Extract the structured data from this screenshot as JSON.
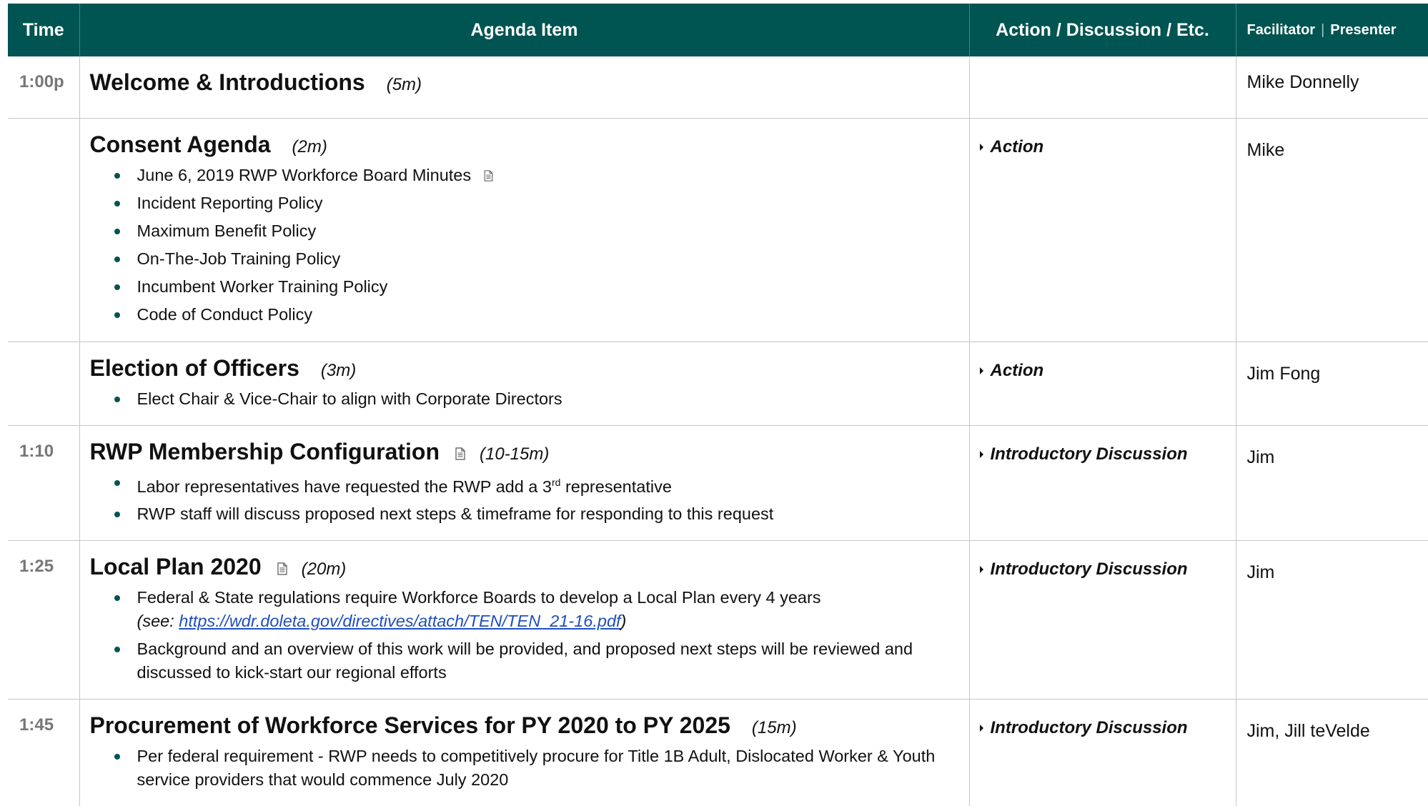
{
  "header": {
    "time": "Time",
    "item": "Agenda Item",
    "action": "Action / Discussion / Etc.",
    "facilitator": "Facilitator",
    "presenter": "Presenter"
  },
  "rows": [
    {
      "time": "1:00p",
      "title": "Welcome & Introductions",
      "duration": "(5m)",
      "bullets": [],
      "action": "",
      "facilitator": "Mike Donnelly"
    },
    {
      "time": "",
      "title": "Consent Agenda",
      "duration": "(2m)",
      "bullets": [
        "June 6, 2019 RWP Workforce Board Minutes",
        "Incident Reporting Policy",
        "Maximum Benefit Policy",
        "On-The-Job Training Policy",
        "Incumbent Worker Training Policy",
        "Code of Conduct Policy"
      ],
      "action": "Action",
      "facilitator": "Mike"
    },
    {
      "time": "",
      "title": "Election of Officers",
      "duration": "(3m)",
      "bullets": [
        "Elect Chair & Vice-Chair to align with Corporate Directors"
      ],
      "action": "Action",
      "facilitator": "Jim Fong"
    },
    {
      "time": "1:10",
      "title": "RWP Membership Configuration",
      "duration": "(10-15m)",
      "bullets": [
        {
          "pre": "Labor representatives have requested the RWP add a 3",
          "sup": "rd",
          "post": " representative"
        },
        "RWP staff will discuss proposed next steps & timeframe for responding to this request"
      ],
      "action": "Introductory Discussion",
      "facilitator": "Jim"
    },
    {
      "time": "1:25",
      "title": "Local Plan 2020",
      "duration": "(20m)",
      "bullets": [
        {
          "text": "Federal & State regulations require Workforce Boards to develop a Local Plan every 4 years",
          "see_prefix": "(see: ",
          "link": "https://wdr.doleta.gov/directives/attach/TEN/TEN_21-16.pdf",
          "see_suffix": ")"
        },
        "Background and an overview of this work will be provided, and proposed next steps will be reviewed and discussed to kick-start our regional efforts"
      ],
      "action": "Introductory Discussion",
      "facilitator": "Jim"
    },
    {
      "time": "1:45",
      "title": "Procurement of Workforce Services for PY 2020 to PY 2025",
      "duration": "(15m)",
      "bullets": [
        "Per federal requirement - RWP needs to competitively procure for Title 1B Adult, Dislocated Worker & Youth service providers that would commence July 2020"
      ],
      "action": "Introductory Discussion",
      "facilitator": "Jim, Jill teVelde"
    }
  ],
  "colors": {
    "header_bg": "#005451",
    "bullet": "#005451",
    "link": "#1f4fbf",
    "time_text": "#777777"
  },
  "icons": {
    "document": "document-icon",
    "action_marker": "triangle-right-icon"
  }
}
